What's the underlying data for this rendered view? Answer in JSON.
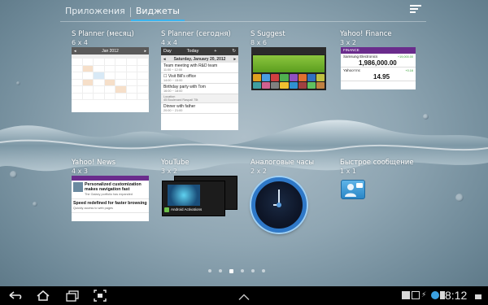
{
  "tabs": [
    {
      "label": "Приложения",
      "active": false
    },
    {
      "label": "Виджеты",
      "active": true
    }
  ],
  "accent_color": "#3bb5f0",
  "widgets": [
    {
      "title": "S Planner (месяц)",
      "size": "6 x 4"
    },
    {
      "title": "S Planner (сегодня)",
      "size": "4 x 4"
    },
    {
      "title": "S Suggest",
      "size": "8 x 6"
    },
    {
      "title": "Yahoo! Finance",
      "size": "3 x 2"
    },
    {
      "title": "Yahoo! News",
      "size": "4 x 3"
    },
    {
      "title": "YouTube",
      "size": "3 x 2"
    },
    {
      "title": "Аналоговые часы",
      "size": "2 x 2"
    },
    {
      "title": "Быстрое сообщение",
      "size": "1 x 1"
    }
  ],
  "planner_month": {
    "month": "Jan 2012"
  },
  "planner_today": {
    "view": "Day",
    "today_button": "Today",
    "date": "Saturday, January 20, 2012",
    "events": [
      {
        "title": "Team meeting with R&D team",
        "time": "11:00 ~ 12:00"
      },
      {
        "title": "Visit Bill's office",
        "time": "14:00 ~ 15:00"
      },
      {
        "title": "Birthday party with Tom",
        "time": "16:00 ~ 18:00"
      },
      {
        "title": "Location",
        "time": "45 Boulevard Raspail 75t"
      },
      {
        "title": "Dinner with father",
        "time": "20:00 ~ 21:00"
      }
    ]
  },
  "finance": {
    "header": "FINANCE",
    "rows": [
      {
        "name": "Samsung Electronics",
        "price": "1,986,000.00",
        "change": "+19,000.00"
      },
      {
        "name": "Yahoo! Inc",
        "price": "14.95",
        "change": "+0.16"
      }
    ]
  },
  "news": {
    "items": [
      {
        "headline": "Personalized customization makes navigation fast",
        "source": "The Galaxy portfolio has expanded"
      },
      {
        "headline": "Speed redefined for faster browsing",
        "source": "Quickly access to web pages"
      }
    ]
  },
  "youtube": {
    "video_title": "Android Activations"
  },
  "page_dots": {
    "count": 6,
    "active_index": 2
  },
  "system_bar": {
    "time": "8:12"
  }
}
